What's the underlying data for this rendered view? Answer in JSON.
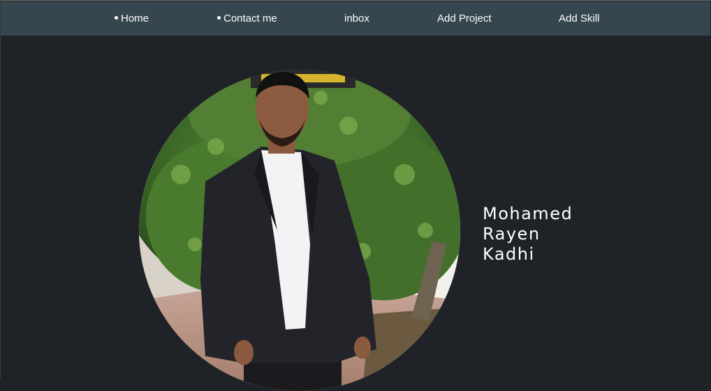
{
  "nav": {
    "items": [
      {
        "label": "Home",
        "bullet": true
      },
      {
        "label": "Contact me",
        "bullet": true
      },
      {
        "label": "inbox",
        "bullet": false
      },
      {
        "label": "Add Project",
        "bullet": false
      },
      {
        "label": "Add Skill",
        "bullet": false
      }
    ]
  },
  "profile": {
    "name_lines": [
      "Mohamed",
      "Rayen",
      "Kadhi"
    ],
    "photo_icon": "profile-photo"
  },
  "colors": {
    "navbar_bg": "#36464f",
    "page_bg": "#1f2328",
    "text": "#ffffff"
  }
}
